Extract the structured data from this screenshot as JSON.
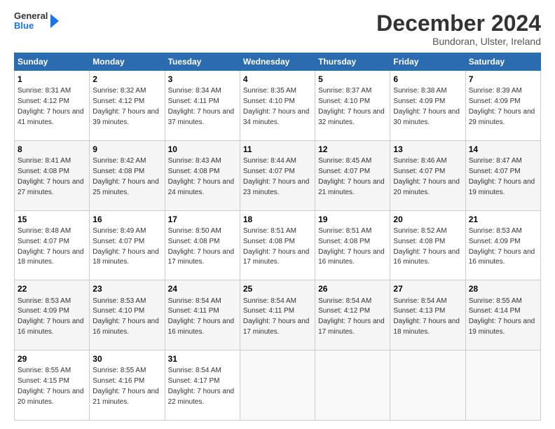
{
  "logo": {
    "text_general": "General",
    "text_blue": "Blue"
  },
  "header": {
    "title": "December 2024",
    "subtitle": "Bundoran, Ulster, Ireland"
  },
  "weekdays": [
    "Sunday",
    "Monday",
    "Tuesday",
    "Wednesday",
    "Thursday",
    "Friday",
    "Saturday"
  ],
  "weeks": [
    [
      {
        "day": "1",
        "sunrise": "8:31 AM",
        "sunset": "4:12 PM",
        "daylight": "7 hours and 41 minutes."
      },
      {
        "day": "2",
        "sunrise": "8:32 AM",
        "sunset": "4:12 PM",
        "daylight": "7 hours and 39 minutes."
      },
      {
        "day": "3",
        "sunrise": "8:34 AM",
        "sunset": "4:11 PM",
        "daylight": "7 hours and 37 minutes."
      },
      {
        "day": "4",
        "sunrise": "8:35 AM",
        "sunset": "4:10 PM",
        "daylight": "7 hours and 34 minutes."
      },
      {
        "day": "5",
        "sunrise": "8:37 AM",
        "sunset": "4:10 PM",
        "daylight": "7 hours and 32 minutes."
      },
      {
        "day": "6",
        "sunrise": "8:38 AM",
        "sunset": "4:09 PM",
        "daylight": "7 hours and 30 minutes."
      },
      {
        "day": "7",
        "sunrise": "8:39 AM",
        "sunset": "4:09 PM",
        "daylight": "7 hours and 29 minutes."
      }
    ],
    [
      {
        "day": "8",
        "sunrise": "8:41 AM",
        "sunset": "4:08 PM",
        "daylight": "7 hours and 27 minutes."
      },
      {
        "day": "9",
        "sunrise": "8:42 AM",
        "sunset": "4:08 PM",
        "daylight": "7 hours and 25 minutes."
      },
      {
        "day": "10",
        "sunrise": "8:43 AM",
        "sunset": "4:08 PM",
        "daylight": "7 hours and 24 minutes."
      },
      {
        "day": "11",
        "sunrise": "8:44 AM",
        "sunset": "4:07 PM",
        "daylight": "7 hours and 23 minutes."
      },
      {
        "day": "12",
        "sunrise": "8:45 AM",
        "sunset": "4:07 PM",
        "daylight": "7 hours and 21 minutes."
      },
      {
        "day": "13",
        "sunrise": "8:46 AM",
        "sunset": "4:07 PM",
        "daylight": "7 hours and 20 minutes."
      },
      {
        "day": "14",
        "sunrise": "8:47 AM",
        "sunset": "4:07 PM",
        "daylight": "7 hours and 19 minutes."
      }
    ],
    [
      {
        "day": "15",
        "sunrise": "8:48 AM",
        "sunset": "4:07 PM",
        "daylight": "7 hours and 18 minutes."
      },
      {
        "day": "16",
        "sunrise": "8:49 AM",
        "sunset": "4:07 PM",
        "daylight": "7 hours and 18 minutes."
      },
      {
        "day": "17",
        "sunrise": "8:50 AM",
        "sunset": "4:08 PM",
        "daylight": "7 hours and 17 minutes."
      },
      {
        "day": "18",
        "sunrise": "8:51 AM",
        "sunset": "4:08 PM",
        "daylight": "7 hours and 17 minutes."
      },
      {
        "day": "19",
        "sunrise": "8:51 AM",
        "sunset": "4:08 PM",
        "daylight": "7 hours and 16 minutes."
      },
      {
        "day": "20",
        "sunrise": "8:52 AM",
        "sunset": "4:08 PM",
        "daylight": "7 hours and 16 minutes."
      },
      {
        "day": "21",
        "sunrise": "8:53 AM",
        "sunset": "4:09 PM",
        "daylight": "7 hours and 16 minutes."
      }
    ],
    [
      {
        "day": "22",
        "sunrise": "8:53 AM",
        "sunset": "4:09 PM",
        "daylight": "7 hours and 16 minutes."
      },
      {
        "day": "23",
        "sunrise": "8:53 AM",
        "sunset": "4:10 PM",
        "daylight": "7 hours and 16 minutes."
      },
      {
        "day": "24",
        "sunrise": "8:54 AM",
        "sunset": "4:11 PM",
        "daylight": "7 hours and 16 minutes."
      },
      {
        "day": "25",
        "sunrise": "8:54 AM",
        "sunset": "4:11 PM",
        "daylight": "7 hours and 17 minutes."
      },
      {
        "day": "26",
        "sunrise": "8:54 AM",
        "sunset": "4:12 PM",
        "daylight": "7 hours and 17 minutes."
      },
      {
        "day": "27",
        "sunrise": "8:54 AM",
        "sunset": "4:13 PM",
        "daylight": "7 hours and 18 minutes."
      },
      {
        "day": "28",
        "sunrise": "8:55 AM",
        "sunset": "4:14 PM",
        "daylight": "7 hours and 19 minutes."
      }
    ],
    [
      {
        "day": "29",
        "sunrise": "8:55 AM",
        "sunset": "4:15 PM",
        "daylight": "7 hours and 20 minutes."
      },
      {
        "day": "30",
        "sunrise": "8:55 AM",
        "sunset": "4:16 PM",
        "daylight": "7 hours and 21 minutes."
      },
      {
        "day": "31",
        "sunrise": "8:54 AM",
        "sunset": "4:17 PM",
        "daylight": "7 hours and 22 minutes."
      },
      null,
      null,
      null,
      null
    ]
  ]
}
